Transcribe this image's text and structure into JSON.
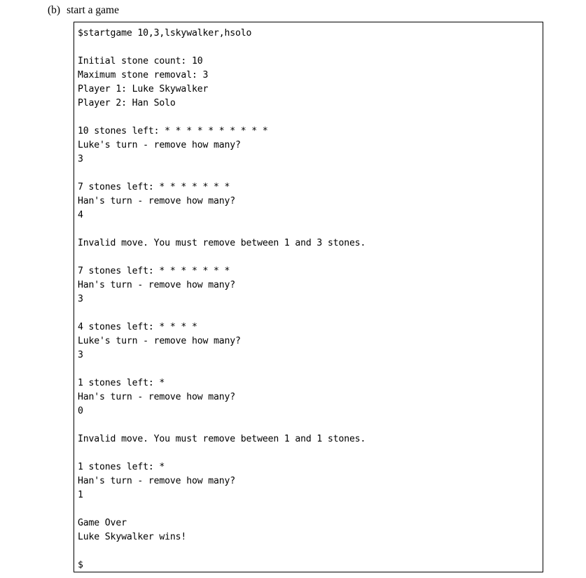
{
  "caption": {
    "label": "(b)",
    "text": "start a game"
  },
  "terminal": {
    "prompt_symbol": "$",
    "command": "$startgame 10,3,lskywalker,hsolo",
    "final_prompt": "$",
    "lines": [
      "$startgame 10,3,lskywalker,hsolo",
      "",
      "Initial stone count: 10",
      "Maximum stone removal: 3",
      "Player 1: Luke Skywalker",
      "Player 2: Han Solo",
      "",
      "10 stones left: * * * * * * * * * *",
      "Luke's turn - remove how many?",
      "3",
      "",
      "7 stones left: * * * * * * *",
      "Han's turn - remove how many?",
      "4",
      "",
      "Invalid move. You must remove between 1 and 3 stones.",
      "",
      "7 stones left: * * * * * * *",
      "Han's turn - remove how many?",
      "3",
      "",
      "4 stones left: * * * *",
      "Luke's turn - remove how many?",
      "3",
      "",
      "1 stones left: *",
      "Han's turn - remove how many?",
      "0",
      "",
      "Invalid move. You must remove between 1 and 1 stones.",
      "",
      "1 stones left: *",
      "Han's turn - remove how many?",
      "1",
      "",
      "Game Over",
      "Luke Skywalker wins!",
      "",
      "$"
    ],
    "game_settings": {
      "initial_stone_count_label": "Initial stone count:",
      "initial_stone_count": "10",
      "maximum_stone_removal_label": "Maximum stone removal:",
      "maximum_stone_removal": "3",
      "player1_label": "Player 1:",
      "player1_name": "Luke Skywalker",
      "player2_label": "Player 2:",
      "player2_name": "Han Solo"
    },
    "turns": [
      {
        "stones_left": "10",
        "stones_display": "* * * * * * * * * *",
        "prompt": "Luke's turn - remove how many?",
        "input": "3",
        "error": ""
      },
      {
        "stones_left": "7",
        "stones_display": "* * * * * * *",
        "prompt": "Han's turn - remove how many?",
        "input": "4",
        "error": "Invalid move. You must remove between 1 and 3 stones."
      },
      {
        "stones_left": "7",
        "stones_display": "* * * * * * *",
        "prompt": "Han's turn - remove how many?",
        "input": "3",
        "error": ""
      },
      {
        "stones_left": "4",
        "stones_display": "* * * *",
        "prompt": "Luke's turn - remove how many?",
        "input": "3",
        "error": ""
      },
      {
        "stones_left": "1",
        "stones_display": "*",
        "prompt": "Han's turn - remove how many?",
        "input": "0",
        "error": "Invalid move. You must remove between 1 and 1 stones."
      },
      {
        "stones_left": "1",
        "stones_display": "*",
        "prompt": "Han's turn - remove how many?",
        "input": "1",
        "error": ""
      }
    ],
    "result": {
      "game_over_label": "Game Over",
      "winner_message": "Luke Skywalker wins!"
    }
  },
  "colors": {
    "text": "#000000",
    "background": "#ffffff",
    "border": "#000000"
  }
}
